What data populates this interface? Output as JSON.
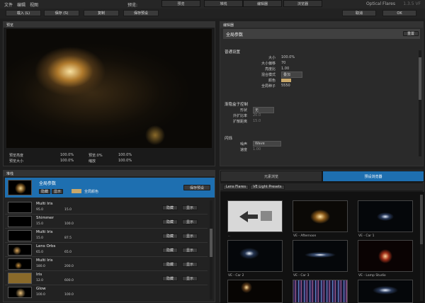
{
  "menu": [
    "文件",
    "编辑",
    "视图"
  ],
  "top_buttons": [
    "载入 (L)",
    "保存 (S)",
    "复制",
    "保存预设"
  ],
  "top_label": "预览:",
  "top_tabs": [
    "预览",
    "堆栈",
    "编辑器",
    "浏览器"
  ],
  "brand": "Optical Flares",
  "version": "1.3.5 VF",
  "right_buttons": [
    "取消",
    "OK"
  ],
  "preview": {
    "header": "预览",
    "stats": [
      {
        "label": "预览亮度",
        "value": "100.0%"
      },
      {
        "label": "预览:0%",
        "value": "100.0%"
      },
      {
        "label": "预览大小",
        "value": "100.0%"
      },
      {
        "label": "缩放",
        "value": "100.0%"
      }
    ]
  },
  "editor": {
    "header": "编辑器",
    "title": "全局参数",
    "title_btn": "重置",
    "section1": "普通设置",
    "props": [
      {
        "k": "大小",
        "v": "100.0%"
      },
      {
        "k": "大小偏移",
        "v": "70"
      },
      {
        "k": "亮度比",
        "v": "1.00"
      },
      {
        "k": "混合模式",
        "v": "叠加"
      },
      {
        "k": "颜色",
        "v": ""
      },
      {
        "k": "全局种子",
        "v": "5550"
      }
    ],
    "section2": "渐隐盒子控制",
    "props2": [
      {
        "k": "形状",
        "v": "无"
      },
      {
        "k": "外扩比率",
        "v": "20.0"
      },
      {
        "k": "扩散距离",
        "v": "15.0"
      }
    ],
    "section3": "闪烁",
    "props3": [
      {
        "k": "噪声",
        "v": "Wave"
      },
      {
        "k": "速度",
        "v": "1.00"
      }
    ]
  },
  "stack": {
    "header": "堆栈",
    "global_label": "全局参数",
    "global_sub": [
      "隐藏",
      "显示"
    ],
    "global_color": "全局颜色",
    "save_btn": "保存预设",
    "items": [
      {
        "name": "Multi Iris",
        "a": "95.0",
        "b": "15.0"
      },
      {
        "name": "Shimmer",
        "a": "15.0",
        "b": "100.0"
      },
      {
        "name": "Multi Iris",
        "a": "15.0",
        "b": "87.5"
      },
      {
        "name": "Lens Orbs",
        "a": "65.0",
        "b": "65.0"
      },
      {
        "name": "Multi Iris",
        "a": "180.0",
        "b": "200.0"
      },
      {
        "name": "Iris",
        "a": "12.0",
        "b": "600.0"
      },
      {
        "name": "Glow",
        "a": "100.0",
        "b": "100.0"
      }
    ],
    "item_btns": [
      "隐藏",
      "显示"
    ]
  },
  "browser": {
    "header": "浏览器",
    "tabs": [
      "元素浏览",
      "预设浏览器"
    ],
    "breadcrumb": [
      "Lens Flares",
      "VE Light Presets"
    ],
    "items": [
      {
        "label": ".."
      },
      {
        "label": "VE - Afternoon"
      },
      {
        "label": "VE - Car 1"
      },
      {
        "label": "VE - Car 2"
      },
      {
        "label": "VE - Car 3"
      },
      {
        "label": "VE - Lamp Studio"
      },
      {
        "label": ""
      },
      {
        "label": ""
      },
      {
        "label": ""
      }
    ]
  },
  "colors": {
    "accent": "#1e6fb0",
    "accent_light": "#2f86c8",
    "panel": "#2a2a2a"
  }
}
